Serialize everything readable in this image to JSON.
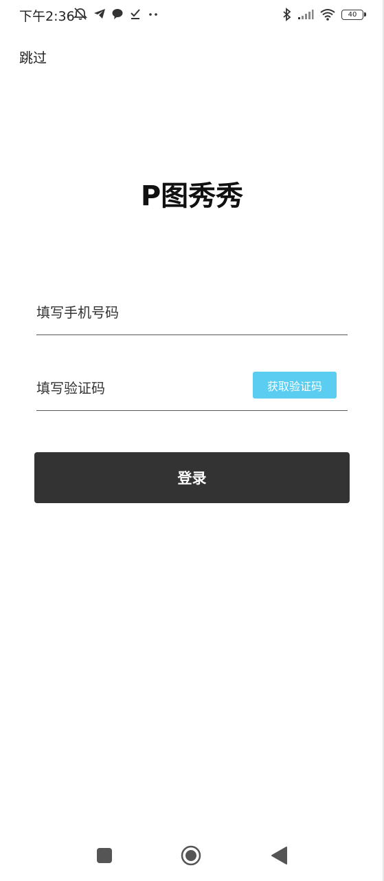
{
  "status_bar": {
    "time": "下午2:36",
    "battery_level": "40",
    "left_icons": [
      "mute-icon",
      "telegram-icon",
      "chat-icon",
      "check-download-icon",
      "more-dots-icon"
    ],
    "right_icons": [
      "bluetooth-icon",
      "signal-icon",
      "wifi-icon",
      "battery-icon"
    ]
  },
  "header": {
    "skip_label": "跳过"
  },
  "main": {
    "app_title": "P图秀秀",
    "phone_placeholder": "填写手机号码",
    "code_placeholder": "填写验证码",
    "get_code_label": "获取验证码",
    "login_label": "登录"
  },
  "colors": {
    "login_button": "#333333",
    "get_code_button": "#5bcdf0",
    "background": "#ffffff"
  },
  "nav_bar": {
    "buttons": [
      "recent-apps-icon",
      "home-icon",
      "back-icon"
    ]
  }
}
